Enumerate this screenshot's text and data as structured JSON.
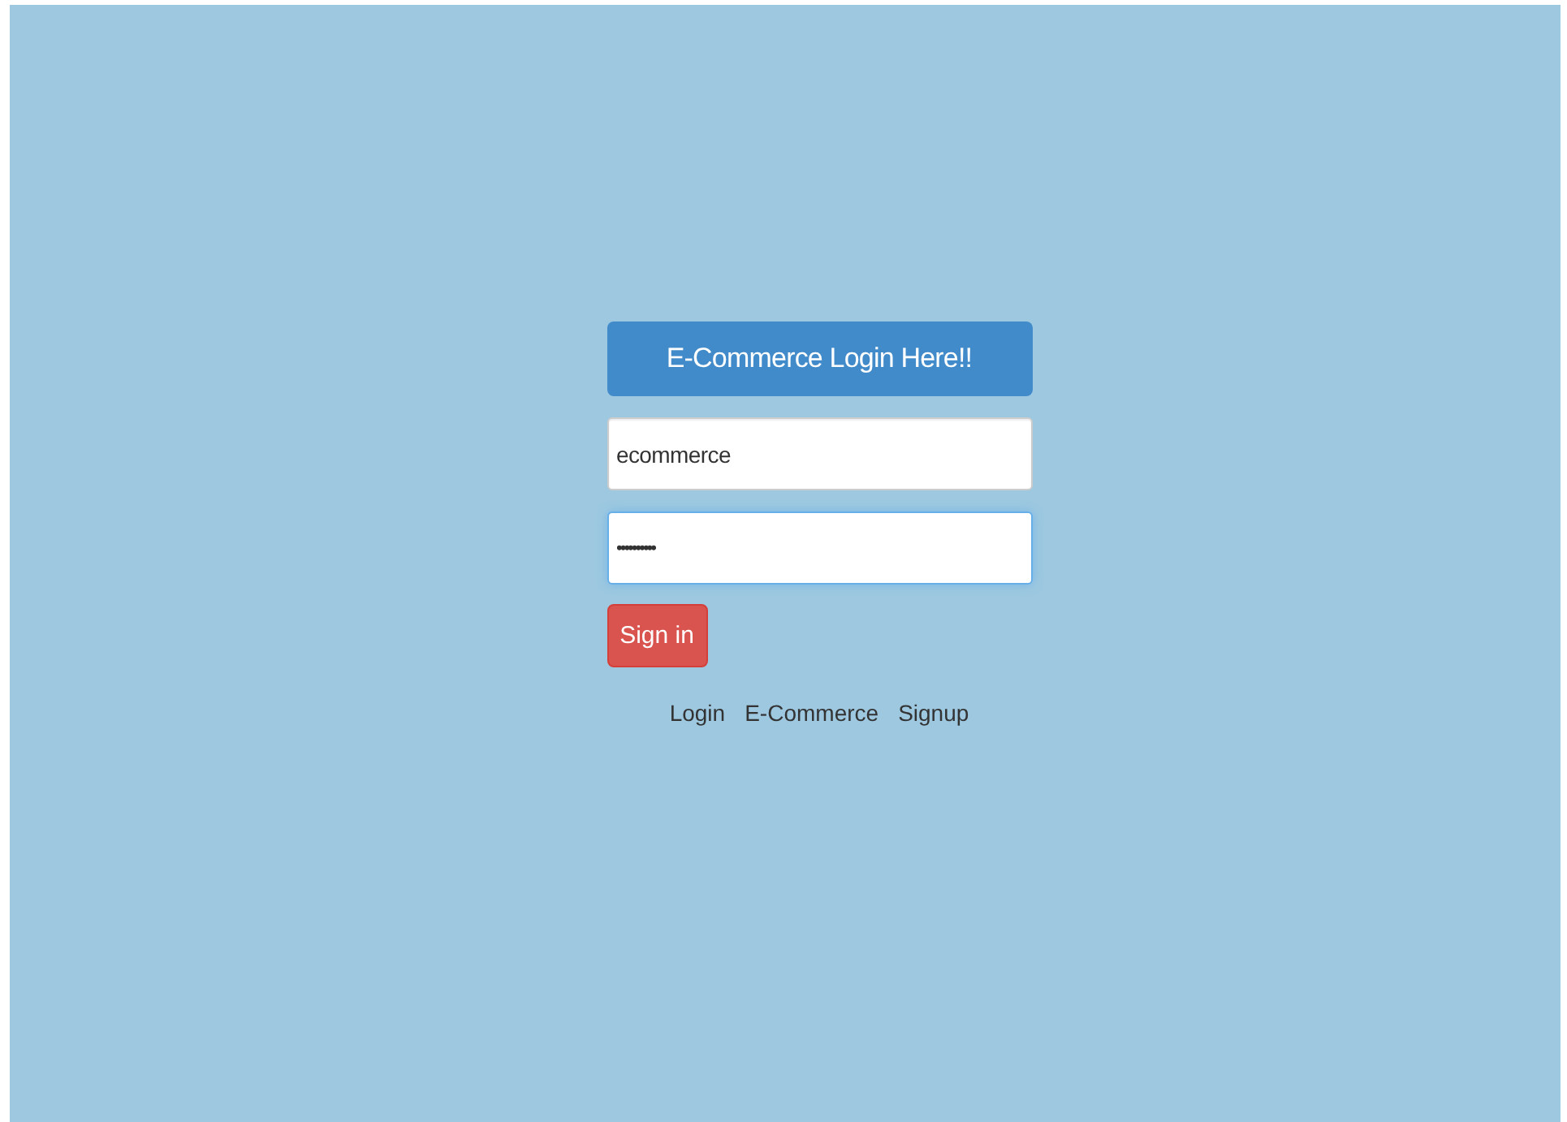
{
  "header": {
    "title": "E-Commerce Login Here!!"
  },
  "fields": [
    {
      "kind": "text",
      "value": "ecommerce",
      "focused": false
    },
    {
      "kind": "password",
      "value": "••••••••••",
      "focused": true
    }
  ],
  "submit": {
    "label": "Sign in"
  },
  "links": [
    {
      "label": "Login"
    },
    {
      "label": "E-Commerce"
    },
    {
      "label": "Signup"
    }
  ]
}
